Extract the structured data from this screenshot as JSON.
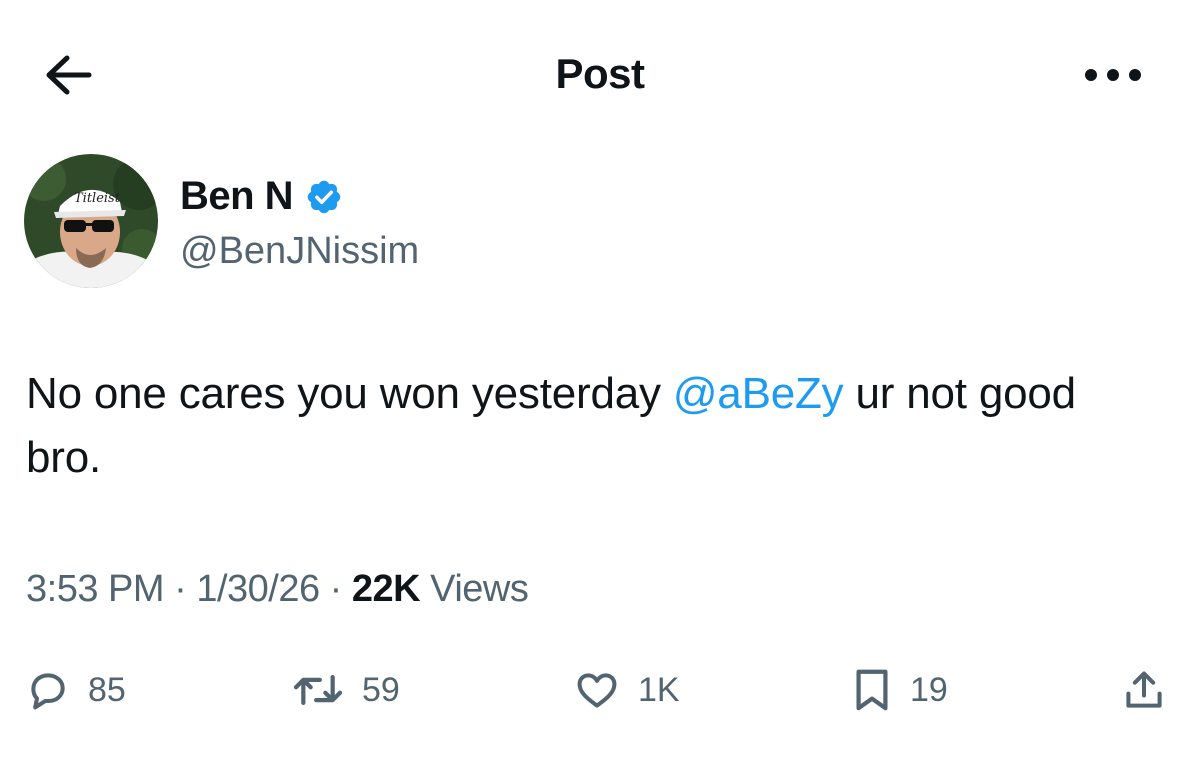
{
  "header": {
    "title": "Post",
    "back_icon": "arrow-left-icon",
    "more_icon": "more-horizontal-icon"
  },
  "author": {
    "name": "Ben N",
    "handle": "@BenJNissim",
    "verified": true,
    "badge_color": "#1d9bf0"
  },
  "tweet": {
    "text_before": "No one cares you won yesterday ",
    "mention": "@aBeZy",
    "text_after": " ur not good bro."
  },
  "meta": {
    "time": "3:53 PM",
    "sep1": " · ",
    "date": "1/30/26",
    "sep2": " · ",
    "views_count": "22K",
    "views_label": " Views"
  },
  "actions": {
    "replies": "85",
    "reposts": "59",
    "likes": "1K",
    "bookmarks": "19"
  },
  "colors": {
    "accent": "#1d9bf0",
    "text": "#0f1419",
    "secondary": "#536471"
  }
}
